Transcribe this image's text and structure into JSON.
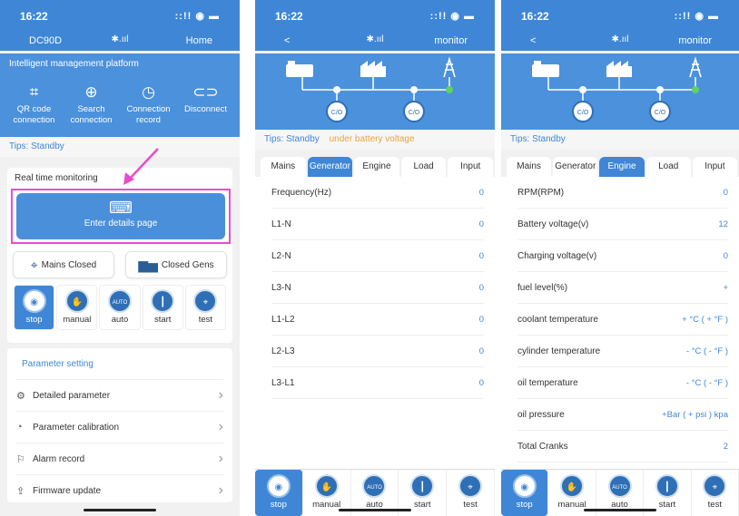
{
  "status": {
    "time": "16:22",
    "signal": "::!! ◉ ▬"
  },
  "panel1": {
    "nav": {
      "left": "DC90D",
      "mid": "✱.ııl",
      "right": "Home"
    },
    "platform_title": "Intelligent management platform",
    "actions": [
      {
        "icon": "qr-scan-icon",
        "glyph": "⌗",
        "label": "QR code connection"
      },
      {
        "icon": "crosshair-icon",
        "glyph": "⊕",
        "label": "Search connection"
      },
      {
        "icon": "history-icon",
        "glyph": "◷",
        "label": "Connection record"
      },
      {
        "icon": "disconnect-icon",
        "glyph": "⊂⊃",
        "label": "Disconnect"
      }
    ],
    "tips_label": "Tips:",
    "tips_value": "Standby",
    "rtm_title": "Real time monitoring",
    "enter_label": "Enter details page",
    "mains_closed": "Mains Closed",
    "closed_gens": "Closed Gens",
    "param_title": "Parameter setting",
    "params": [
      {
        "icon": "gear-icon",
        "glyph": "⚙",
        "label": "Detailed parameter"
      },
      {
        "icon": "calibration-icon",
        "glyph": "◔",
        "label": "Parameter calibration"
      },
      {
        "icon": "alarm-icon",
        "glyph": "⚐",
        "label": "Alarm record"
      },
      {
        "icon": "firmware-icon",
        "glyph": "⇪",
        "label": "Firmware update"
      }
    ]
  },
  "modes": [
    {
      "icon": "stop-icon",
      "glyph": "◉",
      "label": "stop"
    },
    {
      "icon": "hand-icon",
      "glyph": "✋",
      "label": "manual"
    },
    {
      "icon": "auto-icon",
      "glyph": "AUTO",
      "label": "auto"
    },
    {
      "icon": "start-icon",
      "glyph": "┃",
      "label": "start"
    },
    {
      "icon": "tower-icon",
      "glyph": "⌖",
      "label": "test"
    }
  ],
  "panel2": {
    "nav": {
      "left": "<",
      "mid": "✱.ııl",
      "right": "monitor"
    },
    "tips_label": "Tips:",
    "tips_value": "Standby",
    "tips_warn": "under battery voltage",
    "tabs": [
      "Mains",
      "Generator",
      "Engine",
      "Load",
      "Input"
    ],
    "active_tab": 1,
    "rows": [
      {
        "label": "Frequency(Hz)",
        "value": "0"
      },
      {
        "label": "L1-N",
        "value": "0"
      },
      {
        "label": "L2-N",
        "value": "0"
      },
      {
        "label": "L3-N",
        "value": "0"
      },
      {
        "label": "L1-L2",
        "value": "0"
      },
      {
        "label": "L2-L3",
        "value": "0"
      },
      {
        "label": "L3-L1",
        "value": "0"
      }
    ]
  },
  "panel3": {
    "nav": {
      "left": "<",
      "mid": "✱.ııl",
      "right": "monitor"
    },
    "tips_label": "Tips:",
    "tips_value": "Standby",
    "tabs": [
      "Mains",
      "Generator",
      "Engine",
      "Load",
      "Input"
    ],
    "active_tab": 2,
    "rows": [
      {
        "label": "RPM(RPM)",
        "value": "0"
      },
      {
        "label": "Battery voltage(v)",
        "value": "12"
      },
      {
        "label": "Charging voltage(v)",
        "value": "0"
      },
      {
        "label": "fuel level(%)",
        "value": "+"
      },
      {
        "label": "coolant temperature",
        "value": "+ °C   ( + °F )"
      },
      {
        "label": "cylinder temperature",
        "value": "- °C   ( - °F )"
      },
      {
        "label": "oil temperature",
        "value": "- °C   ( - °F )"
      },
      {
        "label": "oil pressure",
        "value": "+Bar ( + psi ) kpa"
      },
      {
        "label": "Total Cranks",
        "value": "2"
      }
    ]
  },
  "diagram": {
    "co_label": "C/O"
  },
  "colors": {
    "primary": "#3f87d6",
    "highlight": "#e84ccd",
    "warning": "#e7a53b",
    "mains_ok": "#5fd35f"
  }
}
